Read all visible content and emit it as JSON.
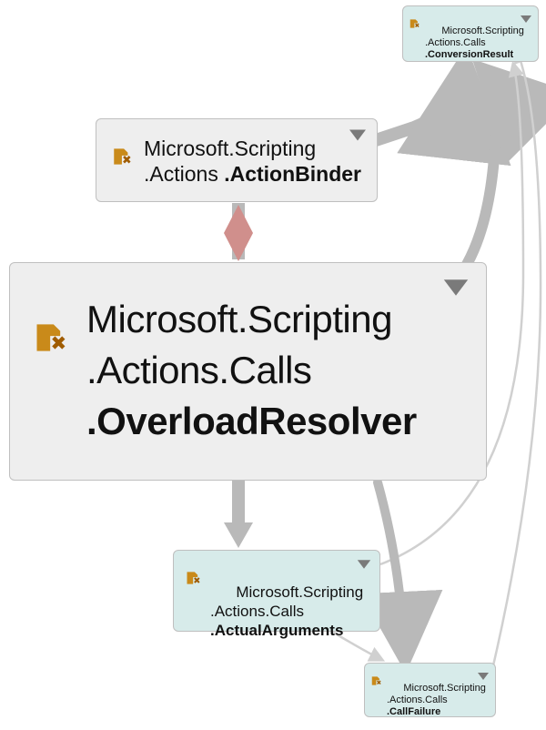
{
  "nodes": {
    "conversionResult": {
      "ns": "Microsoft.Scripting\n.Actions.Calls",
      "cls": ".ConversionResult"
    },
    "actionBinder": {
      "ns": "Microsoft.Scripting\n.Actions ",
      "cls": ".ActionBinder"
    },
    "overloadResolver": {
      "ns": "Microsoft.Scripting\n.Actions.Calls",
      "cls": ".OverloadResolver"
    },
    "actualArguments": {
      "ns": "Microsoft.Scripting\n.Actions.Calls",
      "cls": ".ActualArguments"
    },
    "callFailure": {
      "ns": "Microsoft.Scripting\n.Actions.Calls",
      "cls": ".CallFailure"
    }
  },
  "styles": {
    "nodeGray": "#eeeeee",
    "nodeTeal": "#d7ebea",
    "nodeBorder": "#bfbfbf",
    "edgeMain": "#b9b9b9",
    "edgeLight": "#d0d0d0",
    "edgeDiamond": "#d08f8c",
    "iconPrimary": "#c98a1a",
    "iconAccent": "#a05c00",
    "chevron": "#7a7a7a"
  }
}
